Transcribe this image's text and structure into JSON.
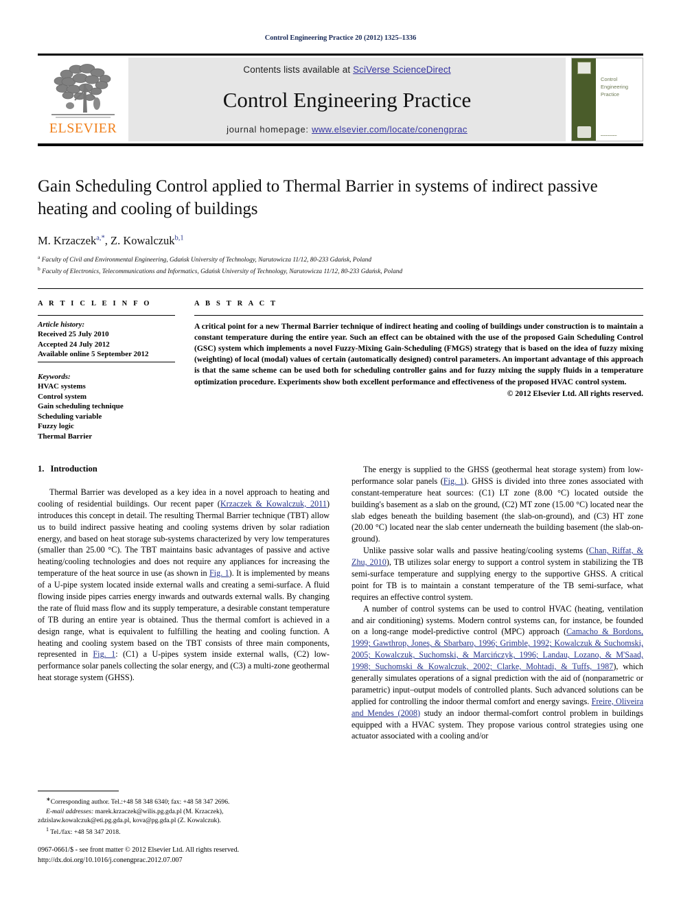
{
  "running_head": "Control Engineering Practice 20 (2012) 1325–1336",
  "masthead": {
    "contents_prefix": "Contents lists available at ",
    "contents_link": "SciVerse ScienceDirect",
    "journal_title": "Control Engineering Practice",
    "homepage_prefix": "journal homepage: ",
    "homepage_link": "www.elsevier.com/locate/conengprac",
    "publisher": "ELSEVIER",
    "cover": {
      "title_line1": "Control",
      "title_line2": "Engineering",
      "title_line3": "Practice"
    }
  },
  "article": {
    "title": "Gain Scheduling Control applied to Thermal Barrier in systems of indirect passive heating and cooling of buildings",
    "authors_part1": "M. Krzaczek",
    "authors_sup1": "a,",
    "authors_star": "*",
    "authors_part2": ", Z. Kowalczuk",
    "authors_sup2": "b,1",
    "affiliation_a_sup": "a",
    "affiliation_a": "Faculty of Civil and Environmental Engineering, Gdańsk University of Technology, Narutowicza 11/12, 80-233 Gdańsk, Poland",
    "affiliation_b_sup": "b",
    "affiliation_b": "Faculty of Electronics, Telecommunications and Informatics, Gdańsk University of Technology, Narutowicza 11/12, 80-233 Gdańsk, Poland"
  },
  "article_info": {
    "heading": "A R T I C L E   I N F O",
    "history_label": "Article history:",
    "received": "Received 25 July 2010",
    "accepted": "Accepted 24 July 2012",
    "available": "Available online 5 September 2012",
    "keywords_label": "Keywords:",
    "keywords": [
      "HVAC systems",
      "Control system",
      "Gain scheduling technique",
      "Scheduling variable",
      "Fuzzy logic",
      "Thermal Barrier"
    ]
  },
  "abstract": {
    "heading": "A B S T R A C T",
    "text": "A critical point for a new Thermal Barrier technique of indirect heating and cooling of buildings under construction is to maintain a constant temperature during the entire year. Such an effect can be obtained with the use of the proposed Gain Scheduling Control (GSC) system which implements a novel Fuzzy-Mixing Gain-Scheduling (FMGS) strategy that is based on the idea of fuzzy mixing (weighting) of local (modal) values of certain (automatically designed) control parameters. An important advantage of this approach is that the same scheme can be used both for scheduling controller gains and for fuzzy mixing the supply fluids in a temperature optimization procedure. Experiments show both excellent performance and effectiveness of the proposed HVAC control system.",
    "copyright": "© 2012 Elsevier Ltd. All rights reserved."
  },
  "introduction": {
    "number": "1.",
    "heading": "Introduction",
    "p1_a": "Thermal Barrier was developed as a key idea in a novel approach to heating and cooling of residential buildings. Our recent paper (",
    "p1_cite1": "Krzaczek & Kowalczuk, 2011",
    "p1_b": ") introduces this concept in detail. The resulting Thermal Barrier technique (TBT) allow us to build indirect passive heating and cooling systems driven by solar radiation energy, and based on heat storage sub-systems characterized by very low temperatures (smaller than 25.00 °C). The TBT maintains basic advantages of passive and active heating/cooling technologies and does not require any appliances for increasing the temperature of the heat source in use (as shown in ",
    "p1_cite2": "Fig. 1",
    "p1_c": "). It is implemented by means of a U-pipe system located inside external walls and creating a semi-surface. A fluid flowing inside pipes carries energy inwards and outwards external walls. By changing the rate of fluid mass flow and its supply temperature, a desirable constant temperature of TB during an entire year is obtained. Thus the thermal comfort is achieved in a design range, what is equivalent to fulfilling the heating and cooling function. A heating and cooling system based on the TBT consists of three main components, represented in ",
    "p1_cite3": "Fig. 1",
    "p1_d": ": (C1) a U-pipes system inside external walls, (C2) low-performance solar panels collecting the solar energy, and (C3) a multi-zone geothermal heat storage system (GHSS)."
  },
  "right_column": {
    "p1_a": "The energy is supplied to the GHSS (geothermal heat storage system) from low-performance solar panels (",
    "p1_cite1": "Fig. 1",
    "p1_b": "). GHSS is divided into three zones associated with constant-temperature heat sources: (C1) LT zone (8.00 °C) located outside the building's basement as a slab on the ground, (C2) MT zone (15.00 °C) located near the slab edges beneath the building basement (the slab-on-ground), and (C3) HT zone (20.00 °C) located near the slab center underneath the building basement (the slab-on-ground).",
    "p2_a": "Unlike passive solar walls and passive heating/cooling systems (",
    "p2_cite1": "Chan, Riffat, & Zhu, 2010",
    "p2_b": "), TB utilizes solar energy to support a control system in stabilizing the TB semi-surface temperature and supplying energy to the supportive GHSS. A critical point for TB is to maintain a constant temperature of the TB semi-surface, what requires an effective control system.",
    "p3_a": "A number of control systems can be used to control HVAC (heating, ventilation and air conditioning) systems. Modern control systems can, for instance, be founded on a long-range model-predictive control (MPC) approach (",
    "p3_cite1": "Camacho & Bordons, 1999; Gawthrop, Jones, & Sbarbaro, 1996; Grimble, 1992; Kowalczuk & Suchomski, 2005; Kowalczuk, Suchomski, & Marcińczyk, 1996; Landau, Lozano, & M'Saad, 1998; Suchomski & Kowalczuk, 2002; Clarke, Mohtadi, & Tuffs, 1987",
    "p3_b": "), which generally simulates operations of a signal prediction with the aid of (nonparametric or parametric) input–output models of controlled plants. Such advanced solutions can be applied for controlling the indoor thermal comfort and energy savings. ",
    "p3_cite2": "Freire, Oliveira and Mendes (2008)",
    "p3_c": " study an indoor thermal-comfort control problem in buildings equipped with a HVAC system. They propose various control strategies using one actuator associated with a cooling and/or"
  },
  "footnotes": {
    "corresponding_marker": "∗",
    "corresponding": "Corresponding author. Tel.:+48 58 348 6340; fax: +48 58 347 2696.",
    "email_label": "E-mail addresses:",
    "email_line1": " marek.krzaczek@wilis.pg.gda.pl (M. Krzaczek),",
    "email_line2": "zdzislaw.kowalczuk@eti.pg.gda.pl, kova@pg.gda.pl (Z. Kowalczuk).",
    "tel_marker": "1",
    "tel_line": "Tel./fax: +48 58 347 2018."
  },
  "footer": {
    "issn_line": "0967-0661/$ - see front matter © 2012 Elsevier Ltd. All rights reserved.",
    "doi_line": "http://dx.doi.org/10.1016/j.conengprac.2012.07.007"
  },
  "colors": {
    "link": "#3333a0",
    "citation": "#26348b",
    "running_head": "#1c2d5a",
    "elsevier_orange": "#f07f1a",
    "cover_green": "#4a5c2a",
    "band_gray": "#e6e6e6"
  }
}
